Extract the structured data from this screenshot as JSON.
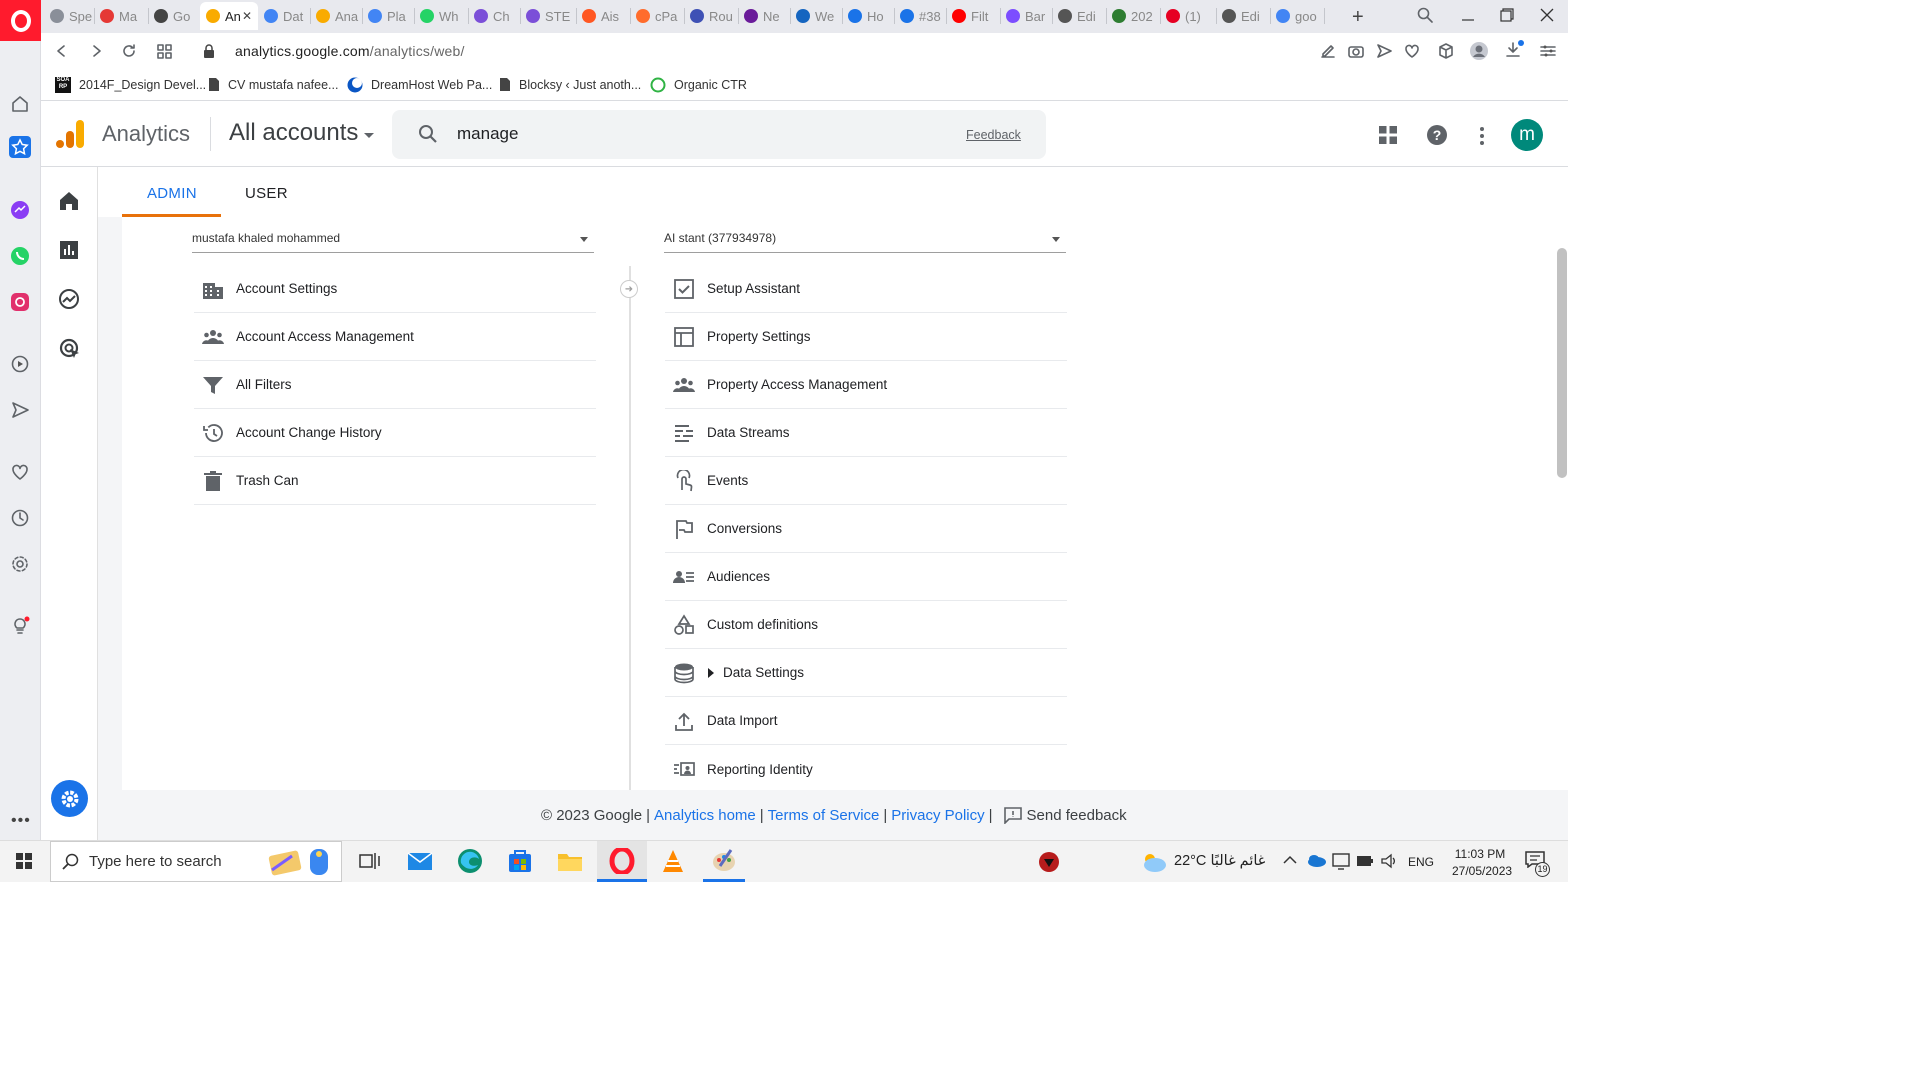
{
  "browser": {
    "tabs": [
      {
        "label": "Spe",
        "color": "#8a8f99"
      },
      {
        "label": "Ma",
        "color": "#e53935"
      },
      {
        "label": "Go",
        "color": "#444"
      },
      {
        "label": "An",
        "color": "#f9ab00"
      },
      {
        "label": "Dat",
        "color": "#4285f4"
      },
      {
        "label": "Ana",
        "color": "#f9ab00"
      },
      {
        "label": "Pla",
        "color": "#4285f4"
      },
      {
        "label": "Wh",
        "color": "#25d366"
      },
      {
        "label": "Ch",
        "color": "#7b4fd8"
      },
      {
        "label": "STE",
        "color": "#7b4fd8"
      },
      {
        "label": "Ais",
        "color": "#ff5722"
      },
      {
        "label": "cPa",
        "color": "#ff6c2c"
      },
      {
        "label": "Rou",
        "color": "#3f51b5"
      },
      {
        "label": "Ne",
        "color": "#6a1b9a"
      },
      {
        "label": "We",
        "color": "#1565c0"
      },
      {
        "label": "Ho",
        "color": "#1a73e8"
      },
      {
        "label": "#38",
        "color": "#1a73e8"
      },
      {
        "label": "Filt",
        "color": "#ff0000"
      },
      {
        "label": "Bar",
        "color": "#7c4dff"
      },
      {
        "label": "Edi",
        "color": "#555"
      },
      {
        "label": "202",
        "color": "#2e7d32"
      },
      {
        "label": "(1)",
        "color": "#e60023"
      },
      {
        "label": "Edi",
        "color": "#555"
      },
      {
        "label": "goo",
        "color": "#4285f4"
      }
    ],
    "active_tab_index": 3,
    "url_domain": "analytics.google.com",
    "url_path": "/analytics/web/",
    "bookmarks": [
      {
        "label": "2014F_Design Devel...",
        "icon": "soarp-icon"
      },
      {
        "label": "CV mustafa nafee...",
        "icon": "document-icon"
      },
      {
        "label": "DreamHost Web Pa...",
        "icon": "dreamhost-icon"
      },
      {
        "label": "Blocksy ‹ Just anoth...",
        "icon": "document-icon"
      },
      {
        "label": "Organic CTR",
        "icon": "organic-ctr-icon"
      }
    ]
  },
  "analytics": {
    "product_name": "Analytics",
    "account_switcher": "All accounts",
    "search_value": "manage",
    "feedback_label": "Feedback",
    "avatar_letter": "m",
    "admin_tabs": {
      "admin": "ADMIN",
      "user": "USER"
    },
    "account_column": {
      "selector": "mustafa khaled mohammed",
      "items": [
        {
          "label": "Account Settings",
          "icon": "building-icon"
        },
        {
          "label": "Account Access Management",
          "icon": "people-icon"
        },
        {
          "label": "All Filters",
          "icon": "filter-icon"
        },
        {
          "label": "Account Change History",
          "icon": "history-icon"
        },
        {
          "label": "Trash Can",
          "icon": "trash-icon"
        }
      ]
    },
    "property_column": {
      "selector": "AI stant (377934978)",
      "items": [
        {
          "label": "Setup Assistant",
          "icon": "checkbox-icon"
        },
        {
          "label": "Property Settings",
          "icon": "layout-icon"
        },
        {
          "label": "Property Access Management",
          "icon": "people-icon"
        },
        {
          "label": "Data Streams",
          "icon": "streams-icon"
        },
        {
          "label": "Events",
          "icon": "touch-icon"
        },
        {
          "label": "Conversions",
          "icon": "flag-icon"
        },
        {
          "label": "Audiences",
          "icon": "audience-icon"
        },
        {
          "label": "Custom definitions",
          "icon": "shapes-icon"
        },
        {
          "label": "Data Settings",
          "icon": "database-icon"
        },
        {
          "label": "Data Import",
          "icon": "upload-icon"
        },
        {
          "label": "Reporting Identity",
          "icon": "identity-icon"
        }
      ]
    },
    "footer": {
      "copyright": "© 2023 Google",
      "analytics_home": "Analytics home",
      "terms": "Terms of Service",
      "privacy": "Privacy Policy",
      "send_feedback": "Send feedback"
    }
  },
  "taskbar": {
    "search_placeholder": "Type here to search",
    "weather": "22°C  غائم غالبًا",
    "language": "ENG",
    "time": "11:03 PM",
    "date": "27/05/2023",
    "notification_count": "19"
  },
  "colors": {
    "accent": "#1a73e8",
    "tab_indicator": "#e8710a",
    "opera_red": "#ff1b2d",
    "avatar": "#00897b"
  }
}
